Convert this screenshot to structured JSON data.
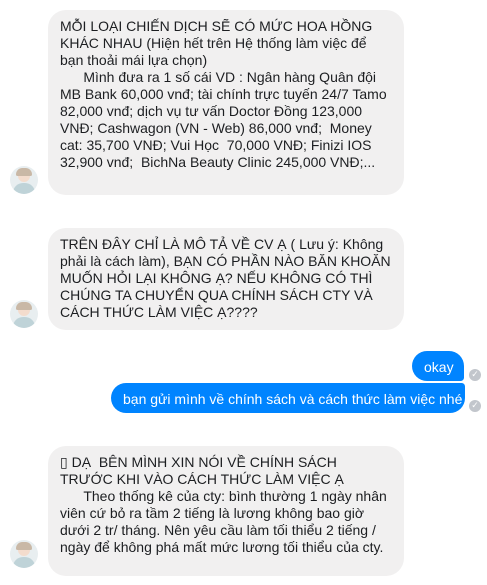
{
  "messages": [
    {
      "text": "MỖI LOẠI CHIẾN DỊCH SẼ CÓ MỨC HOA HỒNG KHÁC NHAU (Hiện hết trên Hệ thống làm việc để bạn thoải mái lựa chọn)\n      Mình đưa ra 1 số cái VD : Ngân hàng Quân đội MB Bank 60,000 vnđ; tài chính trực tuyến 24/7 Tamo 82,000 vnđ; dịch vụ tư vấn Doctor Đồng 123,000 VNĐ; Cashwagon (VN - Web) 86,000 vnđ;  Money cat: 35,700 VNĐ; Vui Học  70,000 VNĐ; Finizi IOS  32,900 vnđ;  BichNa Beauty Clinic 245,000 VNĐ;..."
    },
    {
      "text": "TRÊN ĐÂY CHỈ LÀ MÔ TẢ VỀ CV Ạ ( Lưu ý: Không phải là cách làm), BẠN CÓ PHẦN NÀO BĂN KHOĂN MUỐN HỎI LẠI KHÔNG Ạ? NẾU KHÔNG CÓ THÌ CHÚNG TA CHUYỂN QUA CHÍNH SÁCH CTY VÀ CÁCH THỨC LÀM VIỆC Ạ????"
    },
    {
      "text": "▯ DẠ  BÊN MÌNH XIN NÓI VỀ CHÍNH SÁCH TRƯỚC KHI VÀO CÁCH THỨC LÀM VIỆC Ạ\n      Theo thống kê của cty: bình thường 1 ngày nhân viên cứ bỏ ra tầm 2 tiếng là lương không bao giờ dưới 2 tr/ tháng. Nên yêu cầu làm tối thiểu 2 tiếng / ngày để không phá mất mức lương tối thiểu của cty."
    }
  ],
  "outgoing": [
    {
      "text": "okay"
    },
    {
      "text": "bạn gửi mình về chính sách và cách thức làm việc nhé"
    }
  ],
  "status_icon": "✓",
  "colors": {
    "incoming_bg": "#f1f0f0",
    "outgoing_bg": "#0084ff"
  }
}
